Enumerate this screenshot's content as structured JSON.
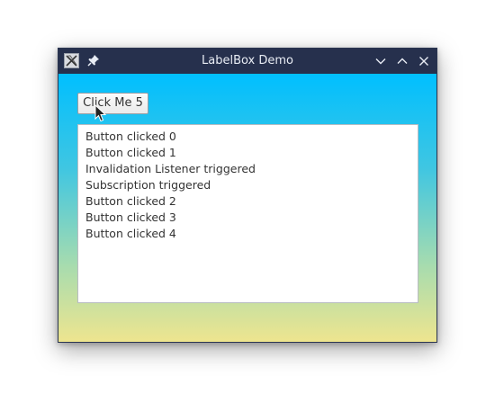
{
  "window": {
    "title": "LabelBox Demo"
  },
  "titlebar": {
    "icons": [
      "app-icon",
      "pin-icon",
      "minimize-icon",
      "maximize-icon",
      "close-icon"
    ]
  },
  "main": {
    "button_label": "Click Me 5",
    "list_items": [
      "Button clicked 0",
      "Button clicked 1",
      "Invalidation Listener triggered",
      "Subscription triggered",
      "Button clicked 2",
      "Button clicked 3",
      "Button clicked 4"
    ]
  },
  "colors": {
    "titlebar": "#26304d",
    "gradient_top": "#00bfff",
    "gradient_bottom": "#eee58f"
  }
}
